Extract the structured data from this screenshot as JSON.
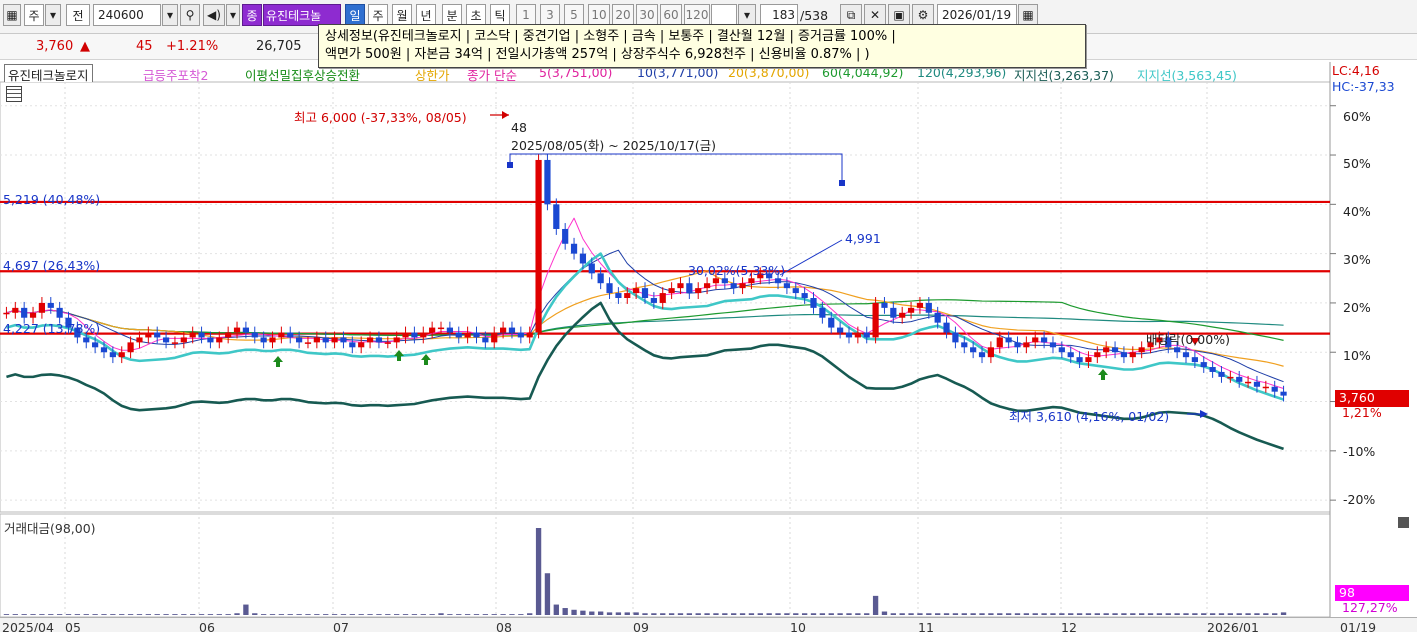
{
  "toolbar": {
    "btn_main": "주",
    "btn_jeon": "전",
    "code": "240600",
    "badge_jong": "종",
    "stock_name": "유진테크놀",
    "period_il": "일",
    "period_ju": "주",
    "period_wol": "월",
    "period_nyeon": "년",
    "period_bun": "분",
    "period_cho": "초",
    "period_tik": "틱",
    "n1": "1",
    "n3": "3",
    "n5": "5",
    "n10": "10",
    "n20": "20",
    "n30": "30",
    "n60": "60",
    "n120": "120",
    "page_count": "183",
    "page_total": "/538",
    "date": "2026/01/19"
  },
  "info": {
    "price": "3,760",
    "arrow": "▲",
    "change": "45",
    "rate": "+1.21%",
    "volume": "26,705"
  },
  "tooltip": {
    "line1": "상세정보(유진테크놀로지 | 코스닥 | 중견기업 | 소형주 | 금속 | 보통주 | 결산월 12월 | 증거금률 100% |",
    "line2": "액면가 500원 | 자본금 34억 | 전일시가총액 257억 | 상장주식수 6,928천주 | 신용비율 0.87% | )"
  },
  "legend": {
    "name": "유진테크놀로지",
    "ind1": "급등주포착2",
    "ind2": "이평선밀집후상승전환",
    "ind3": "상한가",
    "ind4": "종가 단순",
    "ma5": "5(3,751,00)",
    "ma10": "10(3,771,00)",
    "ma20": "20(3,870,00)",
    "ma60": "60(4,044,92)",
    "ma120": "120(4,293,96)",
    "support1": "지지선(3,263,37)",
    "support2": "지지선(3,563,45)",
    "lc": "LC:4,16",
    "hc": "HC:-37,33"
  },
  "annotations": {
    "high": "최고 6,000 (-37,33%, 08/05)",
    "high_bars": "48",
    "range": "2025/08/05(화) ~ 2025/10/17(금)",
    "peak2": "4,991",
    "pct": "30,02%(5,33%)",
    "level1": "5,219 (40,48%)",
    "level2": "4,697 (26,43%)",
    "level3": "4,227 (13,78%)",
    "low": "최저 3,610 (4,16%, 01/02)",
    "bagger": "배당락(0,00%)"
  },
  "right_axis": {
    "ticks": [
      "60%",
      "50%",
      "40%",
      "30%",
      "20%",
      "10%",
      "0%",
      "-10%",
      "-20%"
    ],
    "price": "3,760",
    "price_change": "1,21%"
  },
  "volume_panel": {
    "label": "거래대금(98,00)",
    "value": "98",
    "change": "127,27%"
  },
  "x_axis": {
    "labels": [
      "2025/04",
      "05",
      "06",
      "07",
      "08",
      "09",
      "10",
      "11",
      "12",
      "2026/01",
      "01/19"
    ]
  },
  "colors": {
    "up": "#e00000",
    "down": "#1a48d2",
    "support_line": "#e00000",
    "band_teal": "#3fc7c7",
    "band_dark": "#175a52",
    "ma5": "#ff33cc",
    "ma10": "#1f3fa8",
    "ma20": "#f0a020",
    "ma60": "#1d9a2f",
    "ma120": "#1f8a80"
  },
  "chart_data": {
    "type": "candlestick",
    "y_axis_unit": "% change",
    "ylim": [
      -22,
      64
    ],
    "reference_lines": [
      {
        "label": "5,219 (40,48%)",
        "pct": 40.48
      },
      {
        "label": "4,697 (26,43%)",
        "pct": 26.43
      },
      {
        "label": "4,227 (13,78%)",
        "pct": 13.78
      }
    ],
    "closes_pct": [
      18,
      19,
      17,
      18,
      20,
      19,
      17,
      15,
      13,
      12,
      11,
      10,
      9,
      10,
      12,
      13,
      14,
      13,
      12,
      12,
      13,
      14,
      13,
      12,
      13,
      14,
      15,
      14,
      13,
      12,
      13,
      14,
      13,
      12,
      12,
      13,
      12,
      13,
      12,
      11,
      12,
      13,
      12,
      12,
      13,
      14,
      13,
      14,
      15,
      15,
      14,
      13,
      14,
      13,
      12,
      14,
      15,
      14,
      13,
      14,
      49,
      40,
      35,
      32,
      30,
      28,
      26,
      24,
      22,
      21,
      22,
      23,
      21,
      20,
      22,
      23,
      24,
      22,
      23,
      24,
      25,
      24,
      23,
      24,
      25,
      26,
      25,
      24,
      23,
      22,
      21,
      19,
      17,
      15,
      14,
      13,
      14,
      13,
      20,
      19,
      17,
      18,
      19,
      20,
      18,
      16,
      14,
      12,
      11,
      10,
      9,
      11,
      13,
      12,
      11,
      12,
      13,
      12,
      11,
      10,
      9,
      8,
      9,
      10,
      11,
      10,
      9,
      10,
      11,
      12,
      13,
      11,
      10,
      9,
      8,
      7,
      6,
      5,
      5,
      4,
      4,
      3,
      3,
      2,
      1.2
    ],
    "volume": [
      1,
      1,
      1,
      1,
      1,
      1,
      1,
      1,
      1,
      1,
      1,
      1,
      1,
      1,
      1,
      1,
      1,
      1,
      1,
      1,
      1,
      1,
      1,
      1,
      1,
      1,
      2,
      12,
      2,
      1,
      1,
      1,
      1,
      1,
      1,
      1,
      1,
      1,
      1,
      1,
      1,
      1,
      1,
      1,
      1,
      1,
      1,
      1,
      1,
      2,
      1,
      1,
      1,
      1,
      1,
      1,
      1,
      1,
      1,
      2,
      100,
      48,
      12,
      8,
      6,
      5,
      4,
      4,
      3,
      3,
      3,
      3,
      2,
      2,
      2,
      2,
      2,
      2,
      2,
      2,
      2,
      2,
      2,
      2,
      2,
      2,
      2,
      2,
      2,
      2,
      2,
      2,
      2,
      2,
      2,
      2,
      2,
      2,
      22,
      4,
      2,
      2,
      2,
      2,
      2,
      2,
      2,
      2,
      2,
      2,
      2,
      2,
      2,
      2,
      2,
      2,
      2,
      2,
      2,
      2,
      2,
      2,
      2,
      2,
      2,
      2,
      2,
      2,
      2,
      2,
      2,
      2,
      2,
      2,
      2,
      2,
      2,
      2,
      2,
      2,
      2,
      2,
      2,
      2,
      3
    ]
  }
}
